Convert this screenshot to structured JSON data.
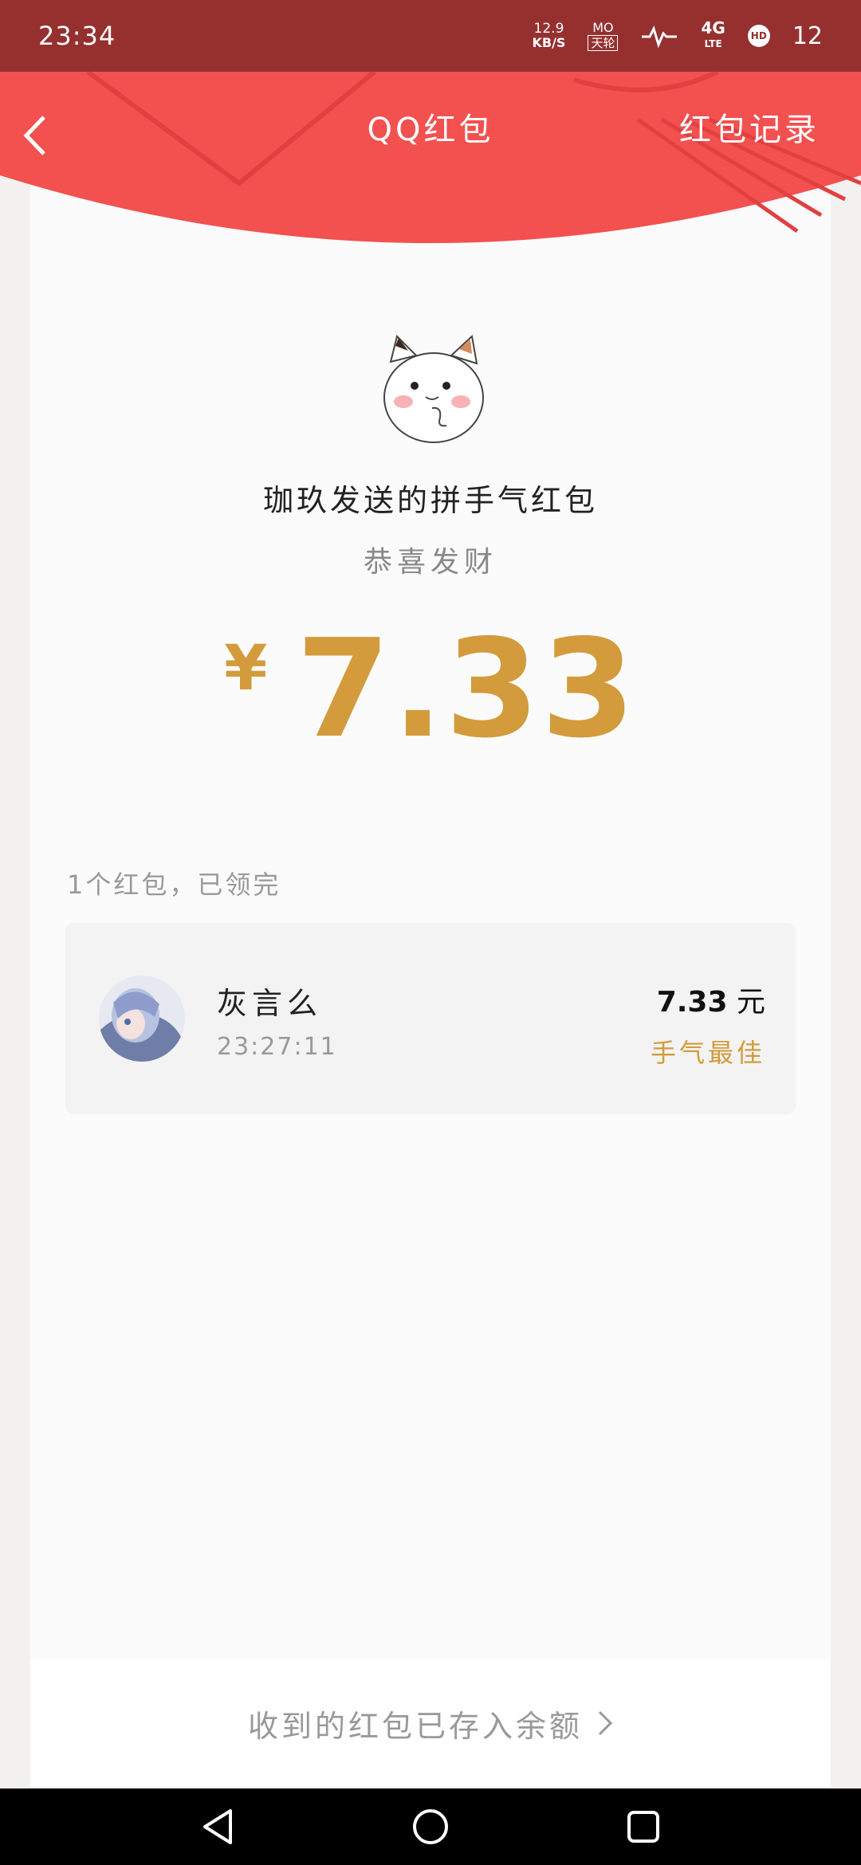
{
  "status_bar": {
    "time": "23:34",
    "net_speed_value": "12.9",
    "net_speed_unit": "KB/S",
    "carrier_top": "MO",
    "carrier_bottom": "天轮",
    "network_type": "4G",
    "network_sub": "LTE",
    "hd_badge": "HD",
    "battery": "12"
  },
  "header": {
    "title": "QQ红包",
    "records_label": "红包记录"
  },
  "packet": {
    "sender_line": "珈玖发送的拼手气红包",
    "greeting": "恭喜发财",
    "currency_symbol": "¥",
    "amount": "7.33"
  },
  "summary": "1个红包，已领完",
  "receiver": {
    "name": "灰言么",
    "time": "23:27:11",
    "amount": "7.33",
    "unit": "元",
    "badge": "手气最佳"
  },
  "footer": {
    "balance_link": "收到的红包已存入余额"
  },
  "colors": {
    "header_red": "#f35050",
    "status_bar": "#96302f",
    "gold": "#d39b3c"
  }
}
